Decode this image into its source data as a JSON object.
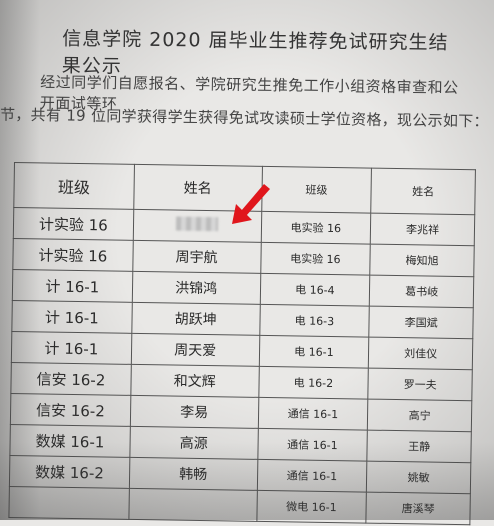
{
  "notice": {
    "title": "信息学院 2020 届毕业生推荐免试研究生结果公示",
    "para_line1": "经过同学们自愿报名、学院研究生推免工作小组资格审查和公开面试等环",
    "para_line2": "节，共有 19 位同学获得学生获得免试攻读硕士学位资格，现公示如下："
  },
  "table": {
    "headers": [
      "班级",
      "姓名",
      "班级",
      "姓名"
    ],
    "rows": [
      {
        "class1": "计实验 16",
        "name1": "",
        "class2": "电实验 16",
        "name2": "李兆祥"
      },
      {
        "class1": "计实验 16",
        "name1": "周宇航",
        "class2": "电实验 16",
        "name2": "梅知旭"
      },
      {
        "class1": "计 16-1",
        "name1": "洪锦鸿",
        "class2": "电 16-4",
        "name2": "葛书岐"
      },
      {
        "class1": "计 16-1",
        "name1": "胡跃坤",
        "class2": "电 16-3",
        "name2": "李国斌"
      },
      {
        "class1": "计 16-1",
        "name1": "周天爱",
        "class2": "电 16-1",
        "name2": "刘佳仪"
      },
      {
        "class1": "信安 16-2",
        "name1": "和文辉",
        "class2": "电 16-2",
        "name2": "罗一夫"
      },
      {
        "class1": "信安 16-2",
        "name1": "李易",
        "class2": "通信 16-1",
        "name2": "高宁"
      },
      {
        "class1": "数媒 16-1",
        "name1": "高源",
        "class2": "通信 16-1",
        "name2": "王静"
      },
      {
        "class1": "数媒 16-2",
        "name1": "韩畅",
        "class2": "通信 16-1",
        "name2": "姚敏"
      },
      {
        "class1": "",
        "name1": "",
        "class2": "微电 16-1",
        "name2": "唐溪琴"
      }
    ]
  },
  "annotation": {
    "arrow_color": "#e0161c"
  }
}
